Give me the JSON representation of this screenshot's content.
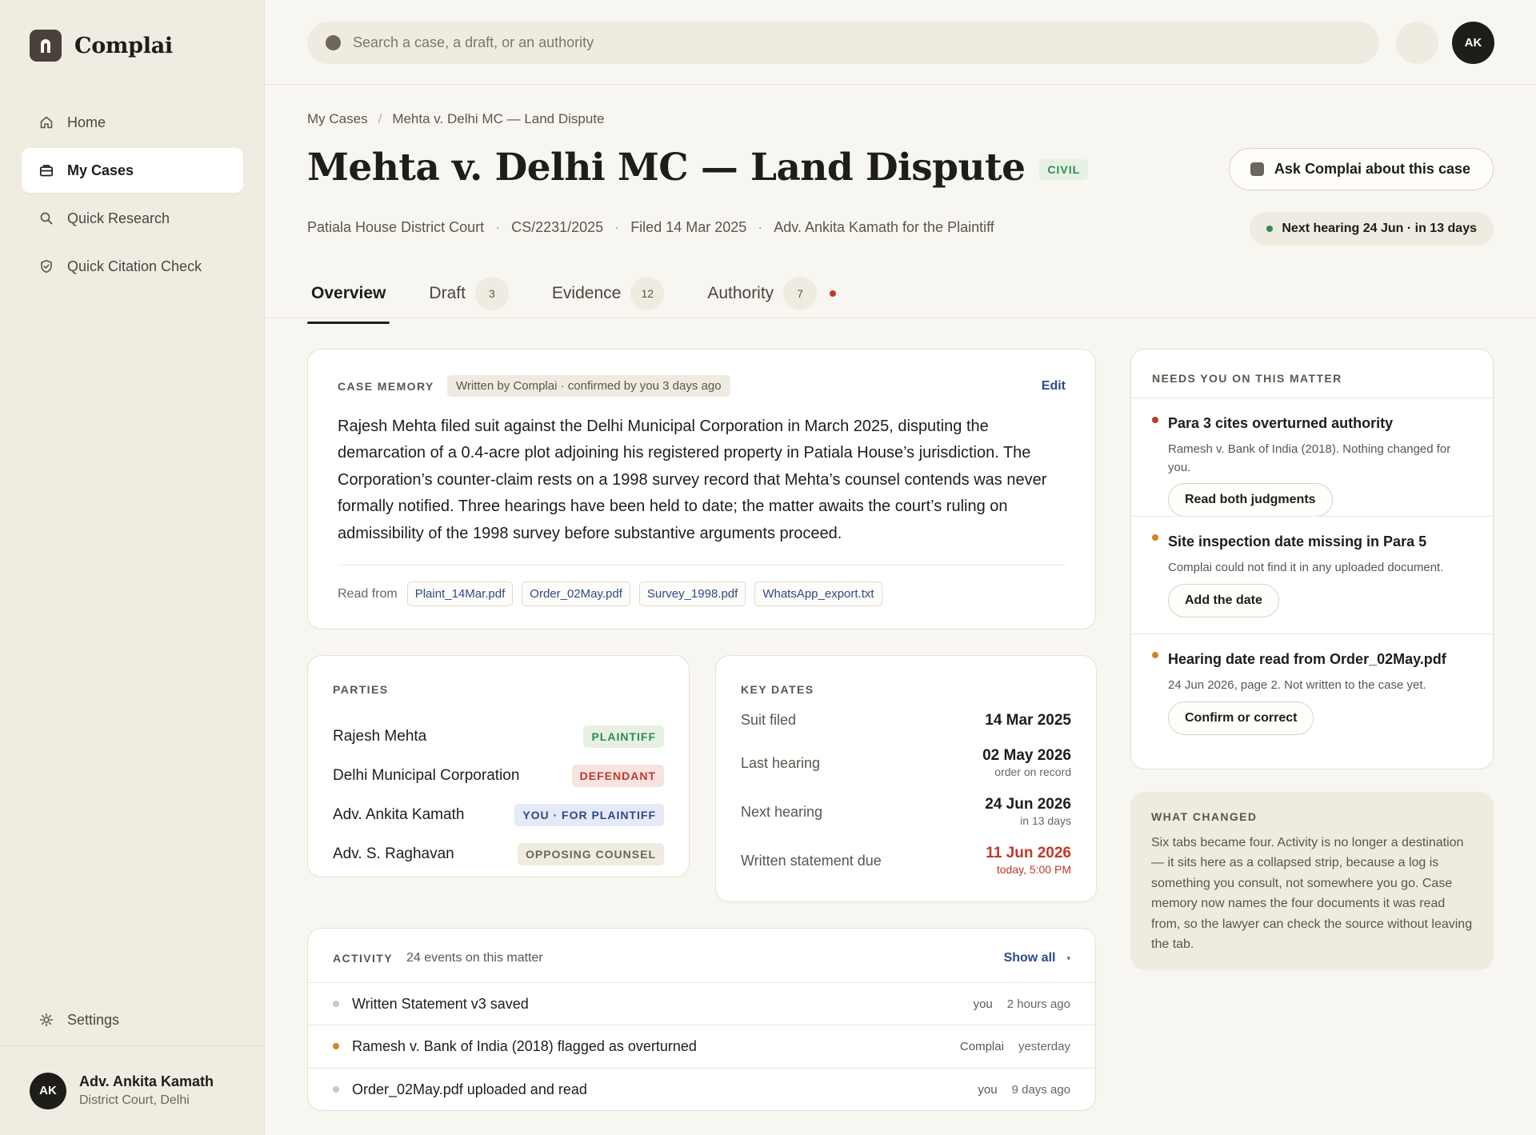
{
  "app": {
    "name": "Complai"
  },
  "sidebar": {
    "items": [
      {
        "label": "Home",
        "icon": "home-icon"
      },
      {
        "label": "My Cases",
        "icon": "briefcase-icon",
        "active": true
      },
      {
        "label": "Quick Research",
        "icon": "search-icon"
      },
      {
        "label": "Quick Citation Check",
        "icon": "shield-check-icon"
      }
    ],
    "settings_label": "Settings",
    "user": {
      "initials": "AK",
      "name": "Adv. Ankita Kamath",
      "court": "District Court, Delhi"
    }
  },
  "topbar": {
    "search_placeholder": "Search a case, a draft, or an authority",
    "avatar_initials": "AK"
  },
  "breadcrumb": {
    "root": "My Cases",
    "separator": "/",
    "current": "Mehta v. Delhi MC — Land Dispute"
  },
  "case": {
    "title": "Mehta v. Delhi MC — Land Dispute",
    "type_tag": "CIVIL",
    "court": "Patiala House District Court",
    "number": "CS/2231/2025",
    "filed": "Filed 14 Mar 2025",
    "counsel": "Adv. Ankita Kamath for the Plaintiff",
    "meta_separator": "·",
    "ask_label": "Ask Complai about this case",
    "next_hearing": "Next hearing 24 Jun · in 13 days"
  },
  "tabs": [
    {
      "label": "Overview",
      "count": null,
      "active": true
    },
    {
      "label": "Draft",
      "count": "3"
    },
    {
      "label": "Evidence",
      "count": "12"
    },
    {
      "label": "Authority",
      "count": "7",
      "flag": true
    }
  ],
  "memory": {
    "label": "CASE MEMORY",
    "note": "Written by Complai · confirmed by you 3 days ago",
    "edit_label": "Edit",
    "body": "Rajesh Mehta filed suit against the Delhi Municipal Corporation in March 2025, disputing the demarcation of a 0.4-acre plot adjoining his registered property in Patiala House’s jurisdiction. The Corporation’s counter-claim rests on a 1998 survey record that Mehta’s counsel contends was never formally notified. Three hearings have been held to date; the matter awaits the court’s ruling on admissibility of the 1998 survey before substantive arguments proceed.",
    "read_from_label": "Read from",
    "sources": [
      "Plaint_14Mar.pdf",
      "Order_02May.pdf",
      "Survey_1998.pdf",
      "WhatsApp_export.txt"
    ]
  },
  "parties": {
    "label": "PARTIES",
    "rows": [
      {
        "name": "Rajesh Mehta",
        "role": "PLAINTIFF",
        "kind": "plaintiff"
      },
      {
        "name": "Delhi Municipal Corporation",
        "role": "DEFENDANT",
        "kind": "defendant"
      },
      {
        "name": "Adv. Ankita Kamath",
        "role": "YOU · FOR PLAINTIFF",
        "kind": "you"
      },
      {
        "name": "Adv. S. Raghavan",
        "role": "OPPOSING COUNSEL",
        "kind": "opposing"
      }
    ]
  },
  "key_dates": {
    "label": "KEY DATES",
    "rows": [
      {
        "label": "Suit filed",
        "value": "14 Mar 2025",
        "sub": ""
      },
      {
        "label": "Last hearing",
        "value": "02 May 2026",
        "sub": "order on record"
      },
      {
        "label": "Next hearing",
        "value": "24 Jun 2026",
        "sub": "in 13 days"
      },
      {
        "label": "Written statement due",
        "value": "11 Jun 2026",
        "sub": "today, 5:00 PM",
        "urgent": true
      }
    ]
  },
  "activity": {
    "label": "ACTIVITY",
    "count": "24 events on this matter",
    "show_all": "Show all",
    "caret": "▾",
    "rows": [
      {
        "text": "Written Statement v3 saved",
        "who": "you",
        "when": "2 hours ago",
        "color": "#cfc9bb"
      },
      {
        "text": "Ramesh v. Bank of India (2018) flagged as overturned",
        "who": "Complai",
        "when": "yesterday",
        "color": "#d4831f"
      },
      {
        "text": "Order_02May.pdf uploaded and read",
        "who": "you",
        "when": "9 days ago",
        "color": "#cfc9bb"
      }
    ]
  },
  "needs": {
    "label": "NEEDS YOU ON THIS MATTER",
    "items": [
      {
        "title": "Para 3 cites overturned authority",
        "desc": "Ramesh v. Bank of India (2018). Nothing changed for you.",
        "action": "Read both judgments",
        "color": "#c0392b"
      },
      {
        "title": "Site inspection date missing in Para 5",
        "desc": "Complai could not find it in any uploaded document.",
        "action": "Add the date",
        "color": "#d4831f"
      },
      {
        "title": "Hearing date read from Order_02May.pdf",
        "desc": "24 Jun 2026, page 2. Not written to the case yet.",
        "action": "Confirm or correct",
        "color": "#d4831f"
      }
    ]
  },
  "what_changed": {
    "label": "WHAT CHANGED",
    "body": "Six tabs became four. Activity is no longer a destination — it sits here as a collapsed strip, because a log is something you consult, not somewhere you go. Case memory now names the four documents it was read from, so the lawyer can check the source without leaving the tab."
  }
}
